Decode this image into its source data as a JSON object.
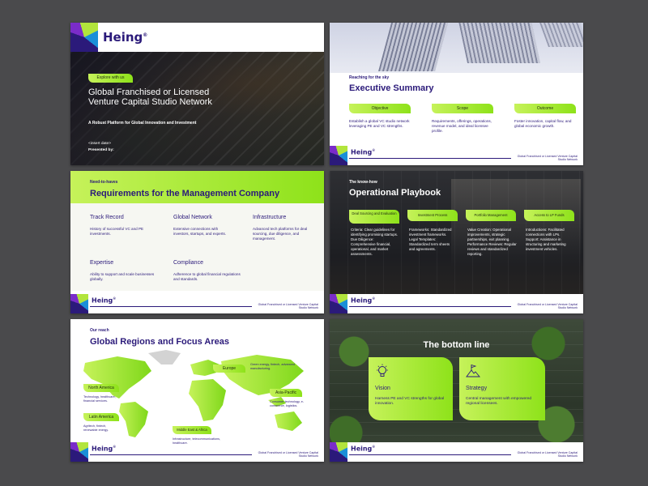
{
  "brand": {
    "name": "Heing",
    "reg": "®"
  },
  "footer_note": "Global Franchised or Licensed Venture Capital Studio Network",
  "slide1": {
    "tag": "Explore with us",
    "title": "Global Franchised or Licensed Venture Capital Studio Network",
    "subtitle": "A Robust Platform for Global Innovation and Investment",
    "date": "<insert date>",
    "presented_by": "Presented by:"
  },
  "slide2": {
    "kicker": "Reaching for the sky",
    "title": "Executive Summary",
    "cols": [
      {
        "label": "Objective",
        "text": "Establish a global VC studio network leveraging PE and VC strengths."
      },
      {
        "label": "Scope",
        "text": "Requirements, offerings, operations, revenue model, and ideal licensee profile."
      },
      {
        "label": "Outcome",
        "text": "Foster innovation, capital flow, and global economic growth."
      }
    ]
  },
  "slide3": {
    "kicker": "Need-to-haves",
    "title": "Requirements for the Management Company",
    "items": [
      {
        "heading": "Track Record",
        "text": "History of successful VC and PE investments."
      },
      {
        "heading": "Global Network",
        "text": "Extensive connections with investors, startups, and experts."
      },
      {
        "heading": "Infrastructure",
        "text": "Advanced tech platforms for deal sourcing, due diligence, and management."
      },
      {
        "heading": "Expertise",
        "text": "Ability to support and scale businesses globally."
      },
      {
        "heading": "Compliance",
        "text": "Adherence to global financial regulations and standards."
      }
    ]
  },
  "slide4": {
    "kicker": "The know-how",
    "title": "Operational Playbook",
    "cols": [
      {
        "label": "Deal Sourcing and Evaluation",
        "text": "Criteria: Clear guidelines for identifying promising startups.\nDue Diligence: Comprehensive financial, operational, and market assessments."
      },
      {
        "label": "Investment Process",
        "text": "Frameworks: Standardized investment frameworks.\nLegal Templates: Standardized term sheets and agreements."
      },
      {
        "label": "Portfolio Management",
        "text": "Value Creation: Operational improvements, strategic partnerships, exit planning.\nPerformance Reviews: Regular reviews and standardized reporting."
      },
      {
        "label": "Access to LP Funds",
        "text": "Introductions: Facilitated connections with LPs.\nSupport: Assistance in structuring and marketing investment vehicles."
      }
    ]
  },
  "slide5": {
    "kicker": "Our reach",
    "title": "Global Regions and Focus Areas",
    "regions": [
      {
        "label": "North America",
        "text": "Technology, healthcare, financial services."
      },
      {
        "label": "Latin America",
        "text": "Agritech, fintech, renewable energy."
      },
      {
        "label": "Europe",
        "text": "Green energy, fintech, advanced manufacturing."
      },
      {
        "label": "Asia-Pacific",
        "text": "Consumer technology, e-commerce, logistics."
      },
      {
        "label": "Middle East & Africa",
        "text": "Infrastructure, telecommunications, healthcare."
      }
    ]
  },
  "slide6": {
    "title": "The bottom line",
    "cards": [
      {
        "icon": "lightbulb-icon",
        "label": "Vision",
        "text": "Harness PE and VC strengths for global innovation."
      },
      {
        "icon": "flag-on-mountain-icon",
        "label": "Strategy",
        "text": "Central management with empowered regional licensees."
      }
    ]
  },
  "colors": {
    "navy": "#2b1a7a",
    "lime": "#b2e53c",
    "lime_dark": "#8ee21a",
    "background": "#4a4a4c"
  }
}
